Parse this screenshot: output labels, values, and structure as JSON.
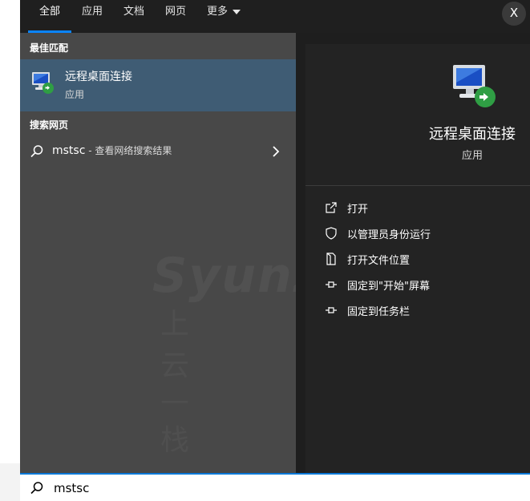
{
  "tabs": [
    {
      "label": "全部",
      "active": true
    },
    {
      "label": "应用",
      "active": false
    },
    {
      "label": "文档",
      "active": false
    },
    {
      "label": "网页",
      "active": false
    },
    {
      "label": "更多",
      "active": false
    }
  ],
  "close_label": "X",
  "best_match": {
    "header": "最佳匹配",
    "app_name": "远程桌面连接",
    "app_type": "应用",
    "icon": "remote-desktop-icon"
  },
  "web_search": {
    "header": "搜索网页",
    "query": "mstsc",
    "hint": " - 查看网络搜索结果"
  },
  "watermark": {
    "en": "Syunz",
    "cn": "上 云 — 栈"
  },
  "detail": {
    "app_name": "远程桌面连接",
    "app_type": "应用",
    "actions": [
      {
        "label": "打开",
        "icon": "open-icon"
      },
      {
        "label": "以管理员身份运行",
        "icon": "shield-icon"
      },
      {
        "label": "打开文件位置",
        "icon": "folder-location-icon"
      },
      {
        "label": "固定到\"开始\"屏幕",
        "icon": "pin-icon"
      },
      {
        "label": "固定到任务栏",
        "icon": "pin-icon"
      }
    ]
  },
  "search": {
    "value": "mstsc",
    "placeholder": ""
  },
  "colors": {
    "accent": "#0078d7",
    "selection": "#3f5c74"
  }
}
